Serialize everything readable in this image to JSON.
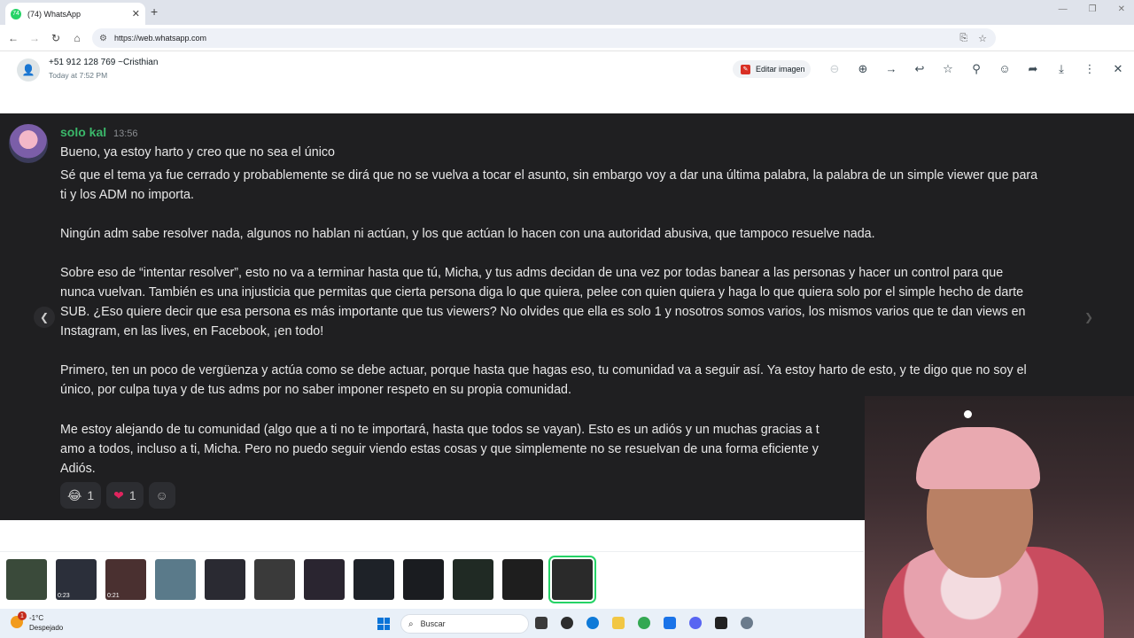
{
  "browser": {
    "tab_title": "(74) WhatsApp",
    "tab_badge": "74",
    "url": "https://web.whatsapp.com"
  },
  "viewer": {
    "contact_name": "+51 912 128 769 ~Cristhian",
    "contact_time": "Today at 7:52 PM",
    "edit_label": "Editar imagen"
  },
  "message": {
    "sender": "solo kal",
    "time": "13:56",
    "lines": [
      "Bueno, ya estoy harto y creo que no sea el único",
      "Sé que el tema ya fue cerrado y probablemente se dirá que no se vuelva a tocar el asunto, sin embargo voy a dar una última palabra, la palabra de un simple viewer que para",
      "ti y los ADM no importa.",
      "Ningún adm sabe resolver nada, algunos no hablan ni actúan, y los que actúan lo hacen con una autoridad abusiva, que tampoco resuelve nada.",
      "Sobre eso de “intentar resolver”, esto no va a terminar hasta que tú, Micha, y tus adms decidan de una vez por todas banear a las personas y hacer un control para que",
      "nunca vuelvan. También es una injusticia que permitas que cierta persona diga lo que quiera, pelee con quien quiera y haga lo que quiera solo por el simple hecho de darte",
      "SUB. ¿Eso quiere decir que esa persona es más importante que tus viewers? No olvides que ella es solo 1 y nosotros somos varios, los mismos varios que te dan views en",
      "Instagram, en las lives, en Facebook, ¡en todo!",
      "Primero, ten un poco de vergüenza y actúa como se debe actuar, porque hasta que hagas eso, tu comunidad va a seguir así. Ya estoy harto de esto, y te digo que no soy el",
      "único, por culpa tuya y de tus adms por no saber imponer respeto en su propia comunidad.",
      "Me estoy alejando de tu comunidad (algo que a ti no te importará, hasta que todos se vayan). Esto es un adiós y un muchas gracias a t",
      "amo a todos, incluso a ti, Micha. Pero no puedo seguir viendo estas cosas y que simplemente no se resuelvan de una forma eficiente y",
      "Adiós."
    ],
    "reactions": [
      {
        "emoji": "😂",
        "count": "1"
      },
      {
        "emoji": "❤",
        "count": "1"
      }
    ]
  },
  "thumbnails": {
    "items": [
      {
        "color": "#3a4a3a",
        "label": ""
      },
      {
        "color": "#2b2f3a",
        "label": "0:23"
      },
      {
        "color": "#4a3030",
        "label": "0:21"
      },
      {
        "color": "#5a7a8a",
        "label": ""
      },
      {
        "color": "#2a2a32",
        "label": ""
      },
      {
        "color": "#3a3a3a",
        "label": ""
      },
      {
        "color": "#2a2530",
        "label": ""
      },
      {
        "color": "#1e2228",
        "label": ""
      },
      {
        "color": "#1a1c20",
        "label": ""
      },
      {
        "color": "#202a24",
        "label": ""
      },
      {
        "color": "#1e1e1e",
        "label": ""
      },
      {
        "color": "#2a2a2a",
        "label": ""
      }
    ],
    "active_index": 11
  },
  "taskbar": {
    "weather_badge": "1",
    "weather_temp": "-1°C",
    "weather_desc": "Despejado",
    "search_label": "Buscar"
  },
  "colors": {
    "whatsapp_green": "#25d366",
    "sender_green": "#3bb86a",
    "media_bg": "#1f1f21"
  }
}
